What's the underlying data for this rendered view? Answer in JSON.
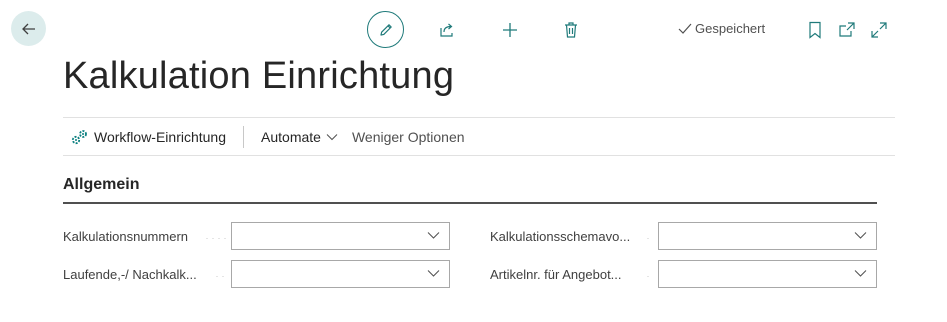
{
  "header": {
    "saved_status": "Gespeichert"
  },
  "page": {
    "title": "Kalkulation Einrichtung"
  },
  "actionbar": {
    "workflow_label": "Workflow-Einrichtung",
    "automate_label": "Automate",
    "fewer_options_label": "Weniger Optionen"
  },
  "section": {
    "title": "Allgemein",
    "fields": [
      {
        "label": "Kalkulationsnummern",
        "value": ""
      },
      {
        "label": "Kalkulationsschemavo...",
        "value": ""
      },
      {
        "label": "Laufende,-/ Nachkalk...",
        "value": ""
      },
      {
        "label": "Artikelnr. für Angebot...",
        "value": ""
      }
    ]
  },
  "colors": {
    "accent": "#1f7a7a",
    "back_button_bg": "#dcecec",
    "workflow_icon": "#0a7f7f"
  },
  "icons": [
    "back-arrow-icon",
    "pencil-icon",
    "share-icon",
    "plus-icon",
    "trash-icon",
    "checkmark-icon",
    "bookmark-icon",
    "popout-icon",
    "expand-icon",
    "workflow-icon",
    "chevron-down-icon"
  ]
}
